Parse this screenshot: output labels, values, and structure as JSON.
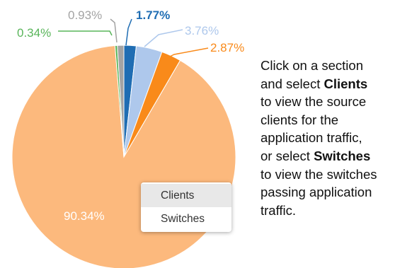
{
  "chart_data": {
    "type": "pie",
    "slices": [
      {
        "label": "90.34%",
        "value": 90.34,
        "color": "#fcb97d"
      },
      {
        "label": "0.34%",
        "value": 0.34,
        "color": "#59b55a"
      },
      {
        "label": "0.93%",
        "value": 0.93,
        "color": "#a3a3a3"
      },
      {
        "label": "1.77%",
        "value": 1.77,
        "color": "#1f6db3"
      },
      {
        "label": "3.76%",
        "value": 3.76,
        "color": "#aec8ec"
      },
      {
        "label": "2.87%",
        "value": 2.87,
        "color": "#f98a1a"
      }
    ]
  },
  "context_menu": {
    "items": [
      {
        "label": "Clients",
        "active": true
      },
      {
        "label": "Switches",
        "active": false
      }
    ]
  },
  "instructions": {
    "line1": "Click on a section",
    "line2_pre": "and select ",
    "line2_bold": "Clients",
    "line3": "to view the source",
    "line4": "clients for the",
    "line5": "application traffic,",
    "line6_pre": "or select ",
    "line6_bold": "Switches",
    "line7": "to view the switches",
    "line8": "passing application",
    "line9": "traffic."
  }
}
